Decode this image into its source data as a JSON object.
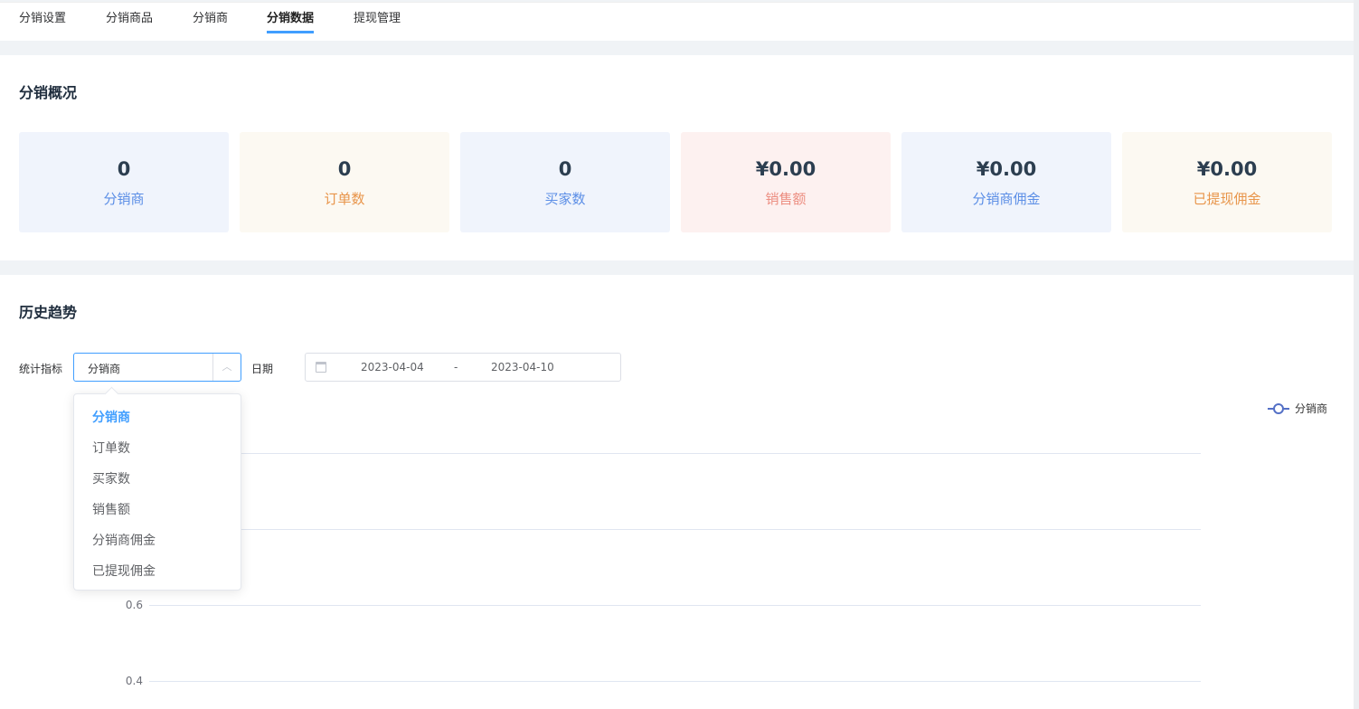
{
  "tabs": [
    {
      "label": "分销设置"
    },
    {
      "label": "分销商品"
    },
    {
      "label": "分销商"
    },
    {
      "label": "分销数据",
      "active": true
    },
    {
      "label": "提现管理"
    }
  ],
  "overview": {
    "title": "分销概况",
    "cards": [
      {
        "value": "0",
        "label": "分销商",
        "bg": "#f0f4fc",
        "color": "#5b8ee6"
      },
      {
        "value": "0",
        "label": "订单数",
        "bg": "#fcf9f2",
        "color": "#e8954a"
      },
      {
        "value": "0",
        "label": "买家数",
        "bg": "#f0f4fc",
        "color": "#5b8ee6"
      },
      {
        "value": "¥0.00",
        "label": "销售额",
        "bg": "#fdf1f0",
        "color": "#ec8d80"
      },
      {
        "value": "¥0.00",
        "label": "分销商佣金",
        "bg": "#f0f4fc",
        "color": "#5b8ee6"
      },
      {
        "value": "¥0.00",
        "label": "已提现佣金",
        "bg": "#fcf9f2",
        "color": "#e8954a"
      }
    ]
  },
  "trend": {
    "title": "历史趋势",
    "metric_label": "统计指标",
    "metric_value": "分销商",
    "date_label": "日期",
    "date_start": "2023-04-04",
    "date_sep": "-",
    "date_end": "2023-04-10",
    "options": [
      "分销商",
      "订单数",
      "买家数",
      "销售额",
      "分销商佣金",
      "已提现佣金"
    ],
    "selected": 0
  },
  "chart_data": {
    "type": "line",
    "legend": "top-right",
    "series": [
      {
        "name": "分销商",
        "color": "#5470c6",
        "values": []
      }
    ],
    "yticks": [
      0.4,
      0.6,
      0.8,
      1.0
    ],
    "visible_ytick_labels": [
      "0.6",
      "0.4"
    ],
    "grid": true
  }
}
